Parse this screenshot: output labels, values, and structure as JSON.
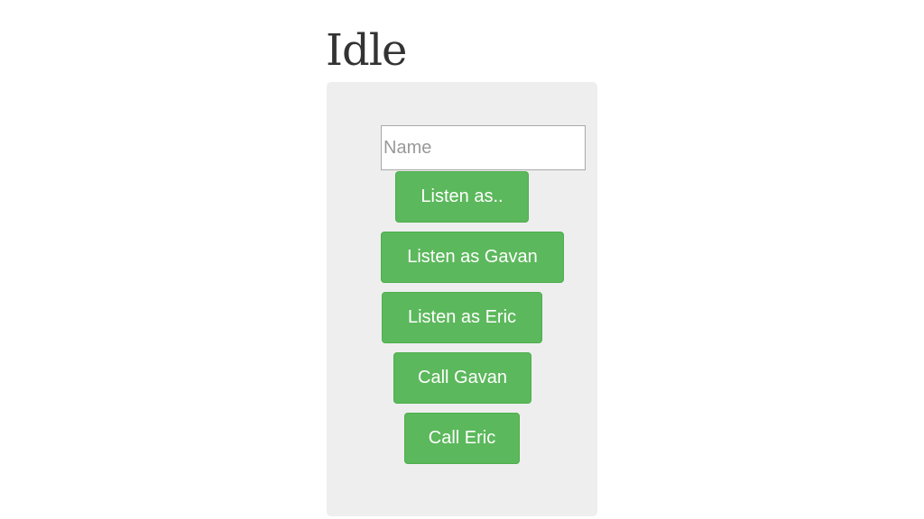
{
  "page": {
    "title": "Idle"
  },
  "form": {
    "name_placeholder": "Name",
    "name_value": ""
  },
  "buttons": {
    "listen_as": "Listen as..",
    "listen_as_gavan": "Listen as Gavan",
    "listen_as_eric": "Listen as Eric",
    "call_gavan": "Call Gavan",
    "call_eric": "Call Eric"
  },
  "colors": {
    "button_bg": "#5cb85c",
    "button_border": "#4cae4c",
    "panel_bg": "#eeeeee",
    "title_text": "#333333"
  }
}
